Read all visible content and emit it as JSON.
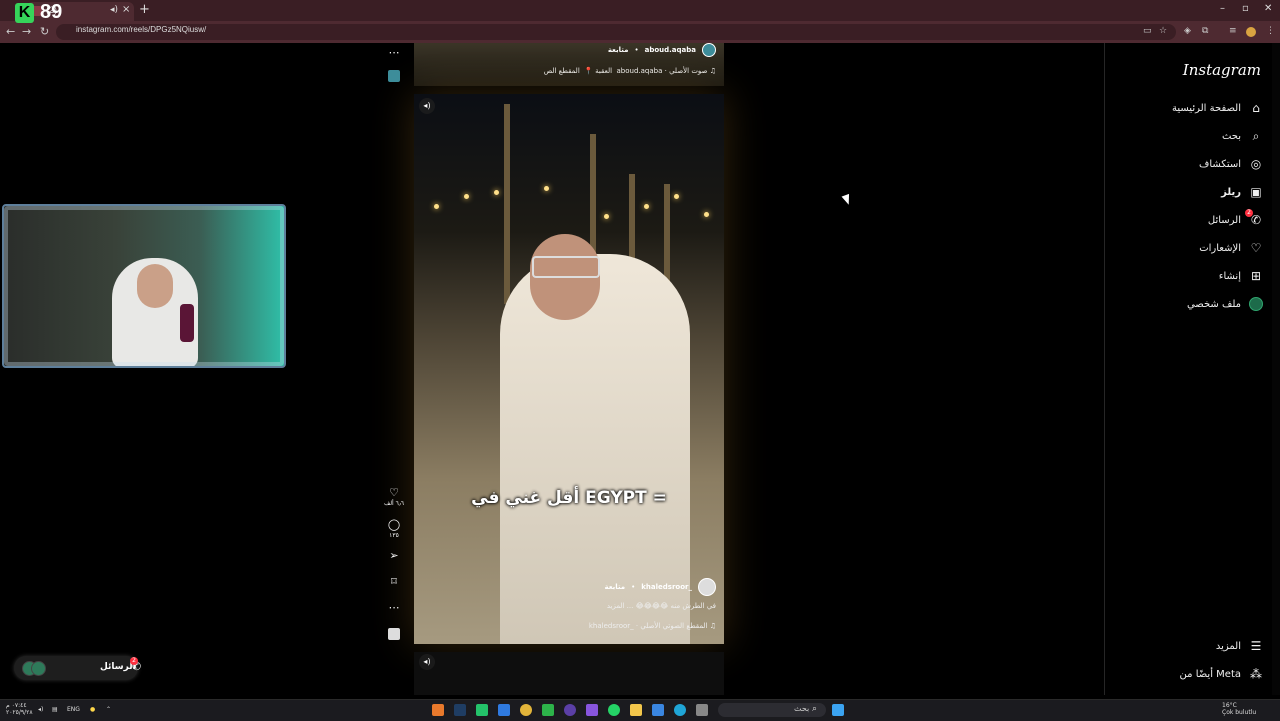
{
  "browser": {
    "tab_title": "(2)",
    "url": "instagram.com/reels/DPGz5NQiusw/",
    "new_tab": "+",
    "win_min": "–",
    "win_max": "▫",
    "win_close": "✕"
  },
  "overlay": {
    "logo_letter": "K",
    "logo_number": "89"
  },
  "sidebar": {
    "logo": "Instagram",
    "items": [
      {
        "label": "الصفحة الرئيسية",
        "icon": "home-icon",
        "glyph": "⌂"
      },
      {
        "label": "بحث",
        "icon": "search-icon",
        "glyph": "⌕"
      },
      {
        "label": "استكشاف",
        "icon": "compass-icon",
        "glyph": "◎"
      },
      {
        "label": "ريلز",
        "icon": "reels-icon",
        "glyph": "▣"
      },
      {
        "label": "الرسائل",
        "icon": "messenger-icon",
        "glyph": "✆",
        "badge": "2"
      },
      {
        "label": "الإشعارات",
        "icon": "heart-icon",
        "glyph": "♡"
      },
      {
        "label": "إنشاء",
        "icon": "plus-square-icon",
        "glyph": "⊞"
      },
      {
        "label": "ملف شخصي",
        "icon": "profile-avatar",
        "glyph": ""
      }
    ],
    "more": "المزيد",
    "meta": "أيضًا من Meta"
  },
  "messages_pill": {
    "label": "الرسائل",
    "badge": "2"
  },
  "reel_top": {
    "username": "aboud.aqaba",
    "follow": "متابعة",
    "audio": "aboud.aqaba · صوت الأصلي",
    "clip": "المقطع الص",
    "location": "العقبة"
  },
  "reel_main": {
    "caption": "أقل غني في EGYPT =",
    "username": "khaledsroor_",
    "follow": "متابعة",
    "description": "في الطرش منه 😂😂😂😂 ... المزيد",
    "audio": "khaledsroor_ · المقطع الصوتي الأصلي"
  },
  "actions": {
    "likes": "٦٫٦ ألف",
    "comments": "١٣٥"
  },
  "taskbar": {
    "search_placeholder": "بحث",
    "lang": "ENG",
    "time": "٠٧:٤٤ م",
    "date": "٢٠٢٥/٩/٢٨",
    "temp": "16°C",
    "weather": "Çok bulutlu"
  }
}
